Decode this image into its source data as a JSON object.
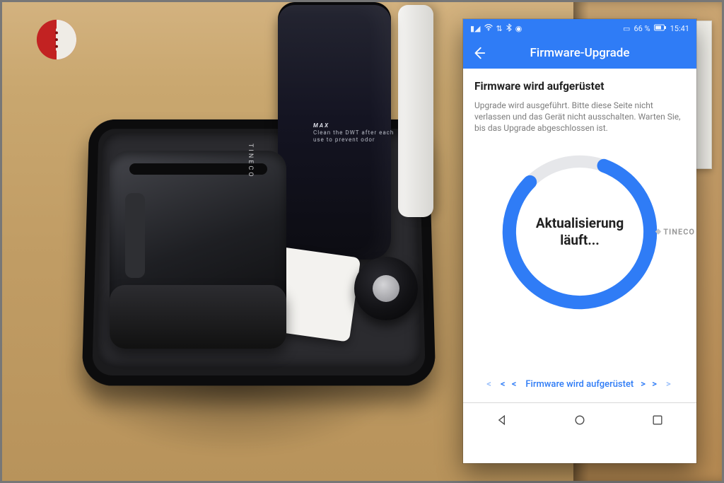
{
  "logo": {
    "name": "site-logo"
  },
  "product": {
    "brand_on_head": "TINECO",
    "tank_label_max": "MAX",
    "tank_label_line1": "Clean the DWT after each",
    "tank_label_line2": "use to prevent odor"
  },
  "phone": {
    "statusbar": {
      "left_icons": [
        "signal-icon",
        "wifi-icon",
        "volte-icon",
        "bluetooth-icon",
        "location-icon"
      ],
      "battery_text": "66 %",
      "vibrate_icon": "vibrate-icon",
      "battery_icon": "battery-icon",
      "time": "15:41"
    },
    "appbar": {
      "title": "Firmware-Upgrade"
    },
    "content": {
      "heading": "Firmware wird aufgerüstet",
      "description": "Upgrade wird ausgeführt. Bitte diese Seite nicht verlassen und das Gerät nicht ausschalten. Warten Sie, bis das Upgrade abgeschlossen ist.",
      "progress_label_line1": "Aktualisierung",
      "progress_label_line2": "läuft...",
      "brand": "TINECO",
      "status_text": "Firmware wird aufgerüstet",
      "progress_ratio": 0.82
    },
    "nav": {
      "back": "back-icon",
      "home": "home-icon",
      "recents": "recents-icon"
    }
  }
}
